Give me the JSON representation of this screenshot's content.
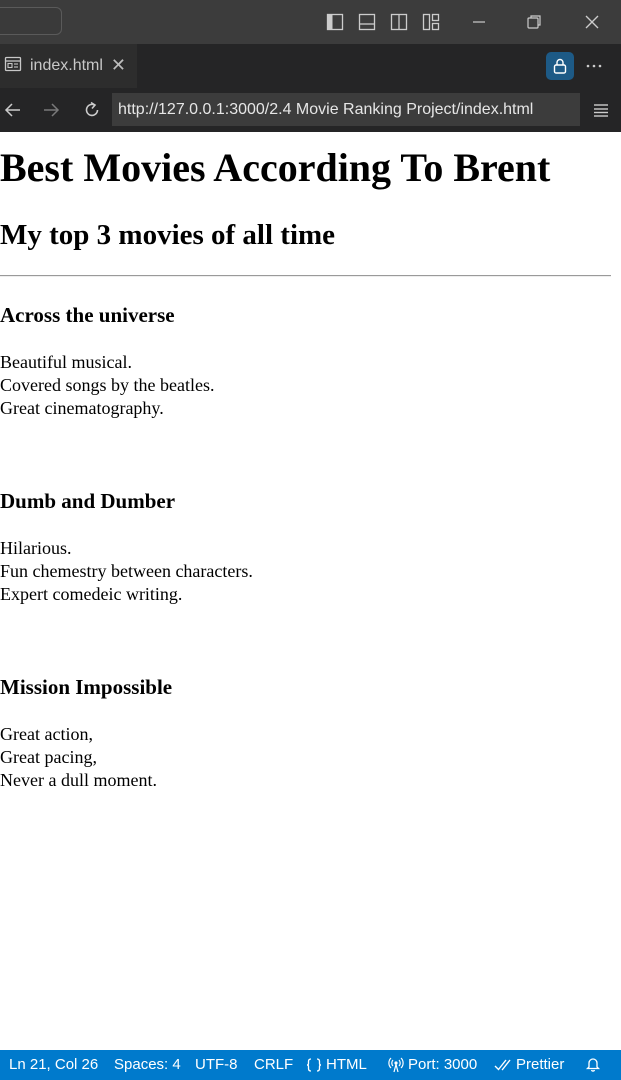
{
  "tab": {
    "label": "index.html",
    "close_glyph": "✕"
  },
  "address_bar": {
    "url": "http://127.0.0.1:3000/2.4 Movie Ranking Project/index.html"
  },
  "page": {
    "heading": "Best Movies According To Brent",
    "subheading": "My top 3 movies of all time",
    "movies": [
      {
        "title": "Across the universe",
        "lines": [
          "Beautiful musical.",
          "Covered songs by the beatles.",
          "Great cinematography."
        ]
      },
      {
        "title": "Dumb and Dumber",
        "lines": [
          "Hilarious.",
          "Fun chemestry between characters.",
          "Expert comedeic writing."
        ]
      },
      {
        "title": "Mission Impossible",
        "lines": [
          "Great action,",
          "Great pacing,",
          "Never a dull moment."
        ]
      }
    ]
  },
  "status_bar": {
    "position": "Ln 21, Col 26",
    "spaces": "Spaces: 4",
    "encoding": "UTF-8",
    "line_ending": "CRLF",
    "language": "HTML",
    "port": "Port: 3000",
    "formatter": "Prettier"
  },
  "icons": {
    "window": [
      "toggle-primary-sidebar-icon",
      "toggle-panel-icon",
      "toggle-secondary-sidebar-icon",
      "customize-layout-icon",
      "minimize-icon",
      "restore-icon",
      "close-window-icon"
    ],
    "browser": [
      "preview-tab-icon",
      "lock-icon",
      "more-icon",
      "back-icon",
      "forward-icon",
      "reload-icon",
      "menu-icon"
    ],
    "status": [
      "braces-icon",
      "broadcast-icon",
      "check-all-icon",
      "bell-icon"
    ]
  },
  "colors": {
    "status_bar": "#007acc",
    "lock_button": "#1d5a86",
    "title_bar": "#3c3c3c",
    "tab_bar": "#252526"
  }
}
